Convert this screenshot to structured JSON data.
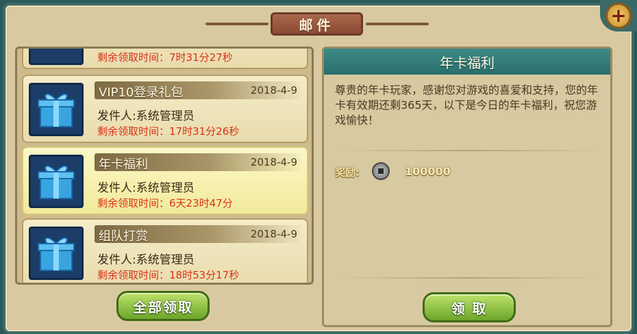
{
  "window": {
    "title": "邮件"
  },
  "close_button": {
    "icon": "plus-close-icon",
    "glyph": "+"
  },
  "mail_list": {
    "partial_top": {
      "remain": "剩余领取时间：7时31分27秒"
    },
    "items": [
      {
        "title": "VIP10登录礼包",
        "date": "2018-4-9",
        "sender": "发件人:系统管理员",
        "remain": "剩余领取时间：17时31分26秒",
        "selected": false,
        "icon": "gift-box-icon"
      },
      {
        "title": "年卡福利",
        "date": "2018-4-9",
        "sender": "发件人:系统管理员",
        "remain": "剩余领取时间：6天23时47分",
        "selected": true,
        "icon": "gift-box-icon"
      },
      {
        "title": "组队打赏",
        "date": "2018-4-9",
        "sender": "发件人:系统管理员",
        "remain": "剩余领取时间：18时53分17秒",
        "selected": false,
        "icon": "gift-box-icon"
      }
    ],
    "claim_all_label": "全部领取"
  },
  "detail": {
    "title": "年卡福利",
    "body": "尊贵的年卡玩家，感谢您对游戏的喜爱和支持，您的年卡有效期还剩365天，以下是今日的年卡福利，祝您游戏愉快！",
    "reward_label": "奖励:",
    "reward_icon": "copper-coin-icon",
    "reward_value": "100000",
    "claim_label": "领 取"
  },
  "colors": {
    "frame": "#3b6a66",
    "panel": "#d9c9a0",
    "accent_teal": "#2a6e6a",
    "button_green": "#6da52a",
    "remain_red": "#d83218"
  }
}
